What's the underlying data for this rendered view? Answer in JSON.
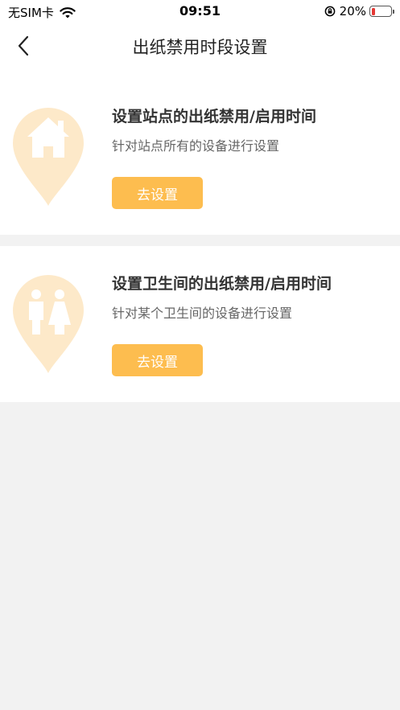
{
  "status_bar": {
    "carrier": "无SIM卡",
    "time": "09:51",
    "battery_pct": "20%",
    "battery_level": 0.2,
    "battery_color": "#e53935"
  },
  "nav": {
    "title": "出纸禁用时段设置"
  },
  "cards": [
    {
      "title": "设置站点的出纸禁用/启用时间",
      "description": "针对站点所有的设备进行设置",
      "button_label": "去设置",
      "icon": "house-location-pin-icon"
    },
    {
      "title": "设置卫生间的出纸禁用/启用时间",
      "description": "针对某个卫生间的设备进行设置",
      "button_label": "去设置",
      "icon": "restroom-location-pin-icon"
    }
  ],
  "colors": {
    "accent": "#fdbd4f",
    "pin": "#fde9c9",
    "background": "#f2f2f2"
  }
}
